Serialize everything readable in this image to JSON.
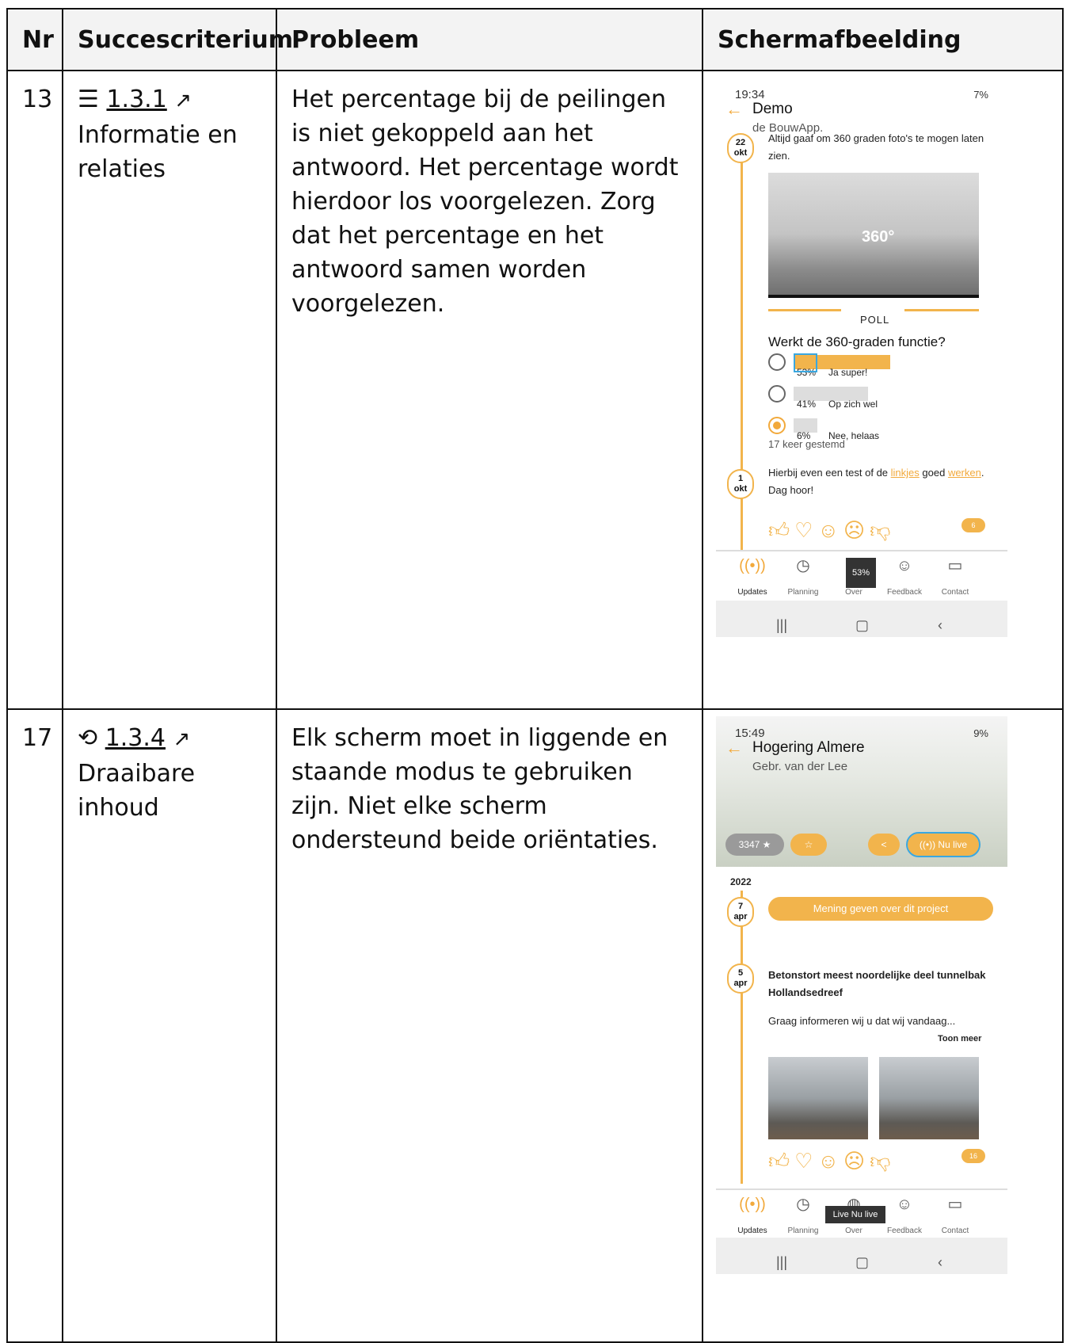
{
  "table": {
    "headers": {
      "nr": "Nr",
      "criterion": "Succescriterium",
      "problem": "Probleem",
      "screenshot": "Schermafbeelding"
    },
    "rows": [
      {
        "nr": "13",
        "icon": "list-icon",
        "criterion_code": "1.3.1",
        "criterion_name": "Informatie en relaties",
        "problem": "Het percentage bij de peilingen is niet gekoppeld aan het antwoord. Het percentage wordt hierdoor los voorgelezen. Zorg dat het percentage en het antwoord samen worden voorgelezen."
      },
      {
        "nr": "17",
        "icon": "rotate-icon",
        "criterion_code": "1.3.4",
        "criterion_name": "Draaibare inhoud",
        "problem": "Elk scherm moet in liggende en staande modus te gebruiken zijn. Niet elke scherm ondersteund beide oriëntaties."
      }
    ]
  },
  "shot1": {
    "time": "19:34",
    "battery": "7%",
    "title": "Demo",
    "subtitle": "de BouwApp.",
    "date1_day": "22",
    "date1_month": "okt",
    "post_text": "Altijd gaaf om 360 graden foto's te mogen laten zien.",
    "pano_label": "360°",
    "poll_label": "POLL",
    "question": "Werkt de 360-graden functie?",
    "options": [
      {
        "pct": "53%",
        "label": "Ja super!",
        "value": 53
      },
      {
        "pct": "41%",
        "label": "Op zich wel",
        "value": 41
      },
      {
        "pct": "6%",
        "label": "Nee, helaas",
        "value": 6
      }
    ],
    "votes": "17 keer gestemd",
    "date2_day": "1",
    "date2_month": "okt",
    "post2_pre": "Hierbij even een test of de ",
    "post2_link1": "linkjes",
    "post2_mid": " goed ",
    "post2_link2": "werken",
    "post2_post": ". Dag hoor!",
    "reactions_count": "6",
    "toast": "53%",
    "nav": [
      "Updates",
      "Planning",
      "Over",
      "Feedback",
      "Contact"
    ]
  },
  "shot2": {
    "time": "15:49",
    "battery": "9%",
    "title": "Hogering Almere",
    "subtitle": "Gebr. van der Lee",
    "rating": "3347",
    "live_label": "Nu live",
    "year": "2022",
    "date1_day": "7",
    "date1_month": "apr",
    "cta": "Mening geven over dit project",
    "date2_day": "5",
    "date2_month": "apr",
    "post_title": "Betonstort meest noordelijke deel tunnelbak Hollandsedreef",
    "post_text": "Graag informeren wij u dat wij vandaag...",
    "more": "Toon meer",
    "reactions_count": "16",
    "toast": "Live Nu live",
    "nav": [
      "Updates",
      "Planning",
      "Over",
      "Feedback",
      "Contact"
    ]
  },
  "colors": {
    "accent": "#f2b44c",
    "focus": "#3aa7e0"
  }
}
